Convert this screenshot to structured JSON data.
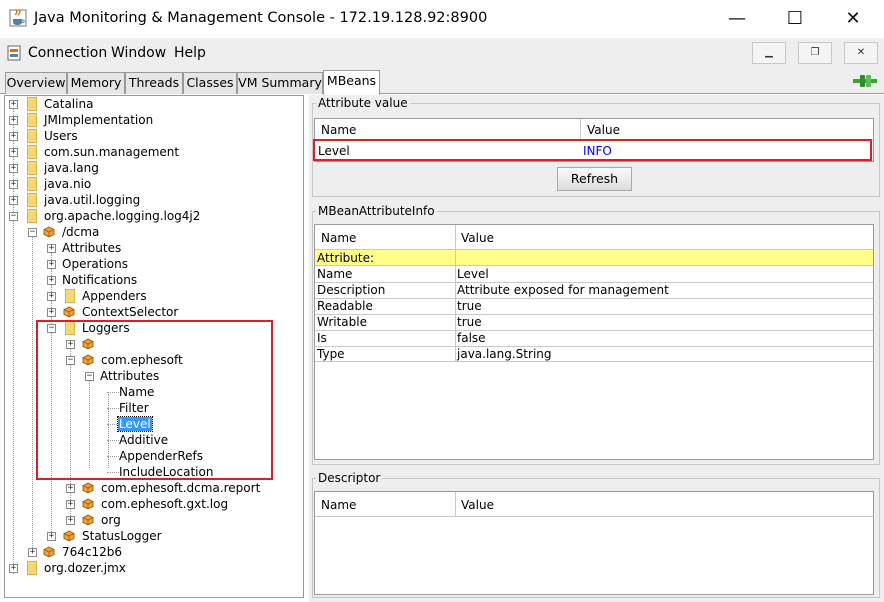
{
  "window": {
    "title": "Java Monitoring & Management Console - 172.19.128.92:8900",
    "minimize": "—",
    "maximize": "☐",
    "close": "✕"
  },
  "menu": {
    "items": [
      "Connection",
      "Window",
      "Help"
    ]
  },
  "tabs": [
    "Overview",
    "Memory",
    "Threads",
    "Classes",
    "VM Summary",
    "MBeans"
  ],
  "active_tab": "MBeans",
  "tree": {
    "catalina": "Catalina",
    "jmimpl": "JMImplementation",
    "users": "Users",
    "comsun": "com.sun.management",
    "javalang": "java.lang",
    "javanio": "java.nio",
    "javautillogging": "java.util.logging",
    "log4j2": "org.apache.logging.log4j2",
    "dcma": "/dcma",
    "attributes": "Attributes",
    "operations": "Operations",
    "notifications": "Notifications",
    "appenders": "Appenders",
    "contextselector": "ContextSelector",
    "loggers": "Loggers",
    "comephesoft": "com.ephesoft",
    "attributes2": "Attributes",
    "name": "Name",
    "filter": "Filter",
    "level": "Level",
    "additive": "Additive",
    "appenderrefs": "AppenderRefs",
    "includelocation": "IncludeLocation",
    "dcmareport": "com.ephesoft.dcma.report",
    "gxtlog": "com.ephesoft.gxt.log",
    "org": "org",
    "statuslogger": "StatusLogger",
    "hash": "764c12b6",
    "dozer": "org.dozer.jmx"
  },
  "attribute_value": {
    "title": "Attribute value",
    "col_name": "Name",
    "col_value": "Value",
    "row_name": "Level",
    "row_value": "INFO",
    "refresh": "Refresh"
  },
  "attr_info": {
    "title": "MBeanAttributeInfo",
    "col_name": "Name",
    "col_value": "Value",
    "section": "Attribute:",
    "rows": [
      {
        "name": "Name",
        "value": "Level"
      },
      {
        "name": "Description",
        "value": "Attribute exposed for management"
      },
      {
        "name": "Readable",
        "value": "true"
      },
      {
        "name": "Writable",
        "value": "true"
      },
      {
        "name": "Is",
        "value": "false"
      },
      {
        "name": "Type",
        "value": "java.lang.String"
      }
    ]
  },
  "descriptor": {
    "title": "Descriptor",
    "col_name": "Name",
    "col_value": "Value"
  },
  "colors": {
    "highlight": "#d9202a",
    "section_row": "#ffff88",
    "selection": "#3399ff",
    "link_value": "#0000ff"
  }
}
